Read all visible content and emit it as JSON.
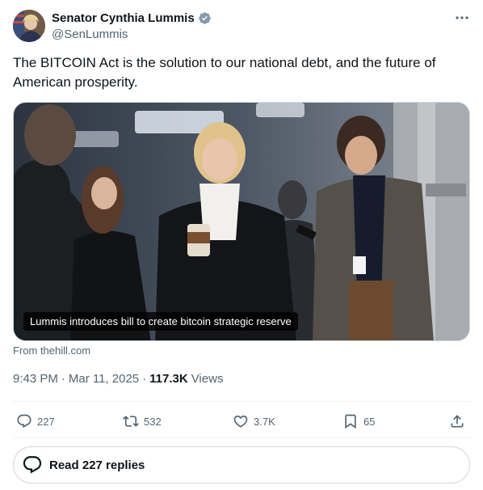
{
  "author": {
    "name": "Senator Cynthia Lummis",
    "handle": "@SenLummis",
    "verified_color": "#829aab"
  },
  "tweet": {
    "text": "The BITCOIN Act is the solution to our national debt, and the future of American prosperity."
  },
  "media": {
    "caption": "Lummis introduces bill to create bitcoin strategic reserve",
    "source": "From thehill.com"
  },
  "meta": {
    "time": "9:43 PM",
    "separator1": "·",
    "date": "Mar 11, 2025",
    "separator2": "·",
    "views_count": "117.3K",
    "views_label": "Views"
  },
  "actions": {
    "replies": "227",
    "retweets": "532",
    "likes": "3.7K",
    "bookmarks": "65"
  },
  "read_replies": {
    "label": "Read 227 replies"
  }
}
